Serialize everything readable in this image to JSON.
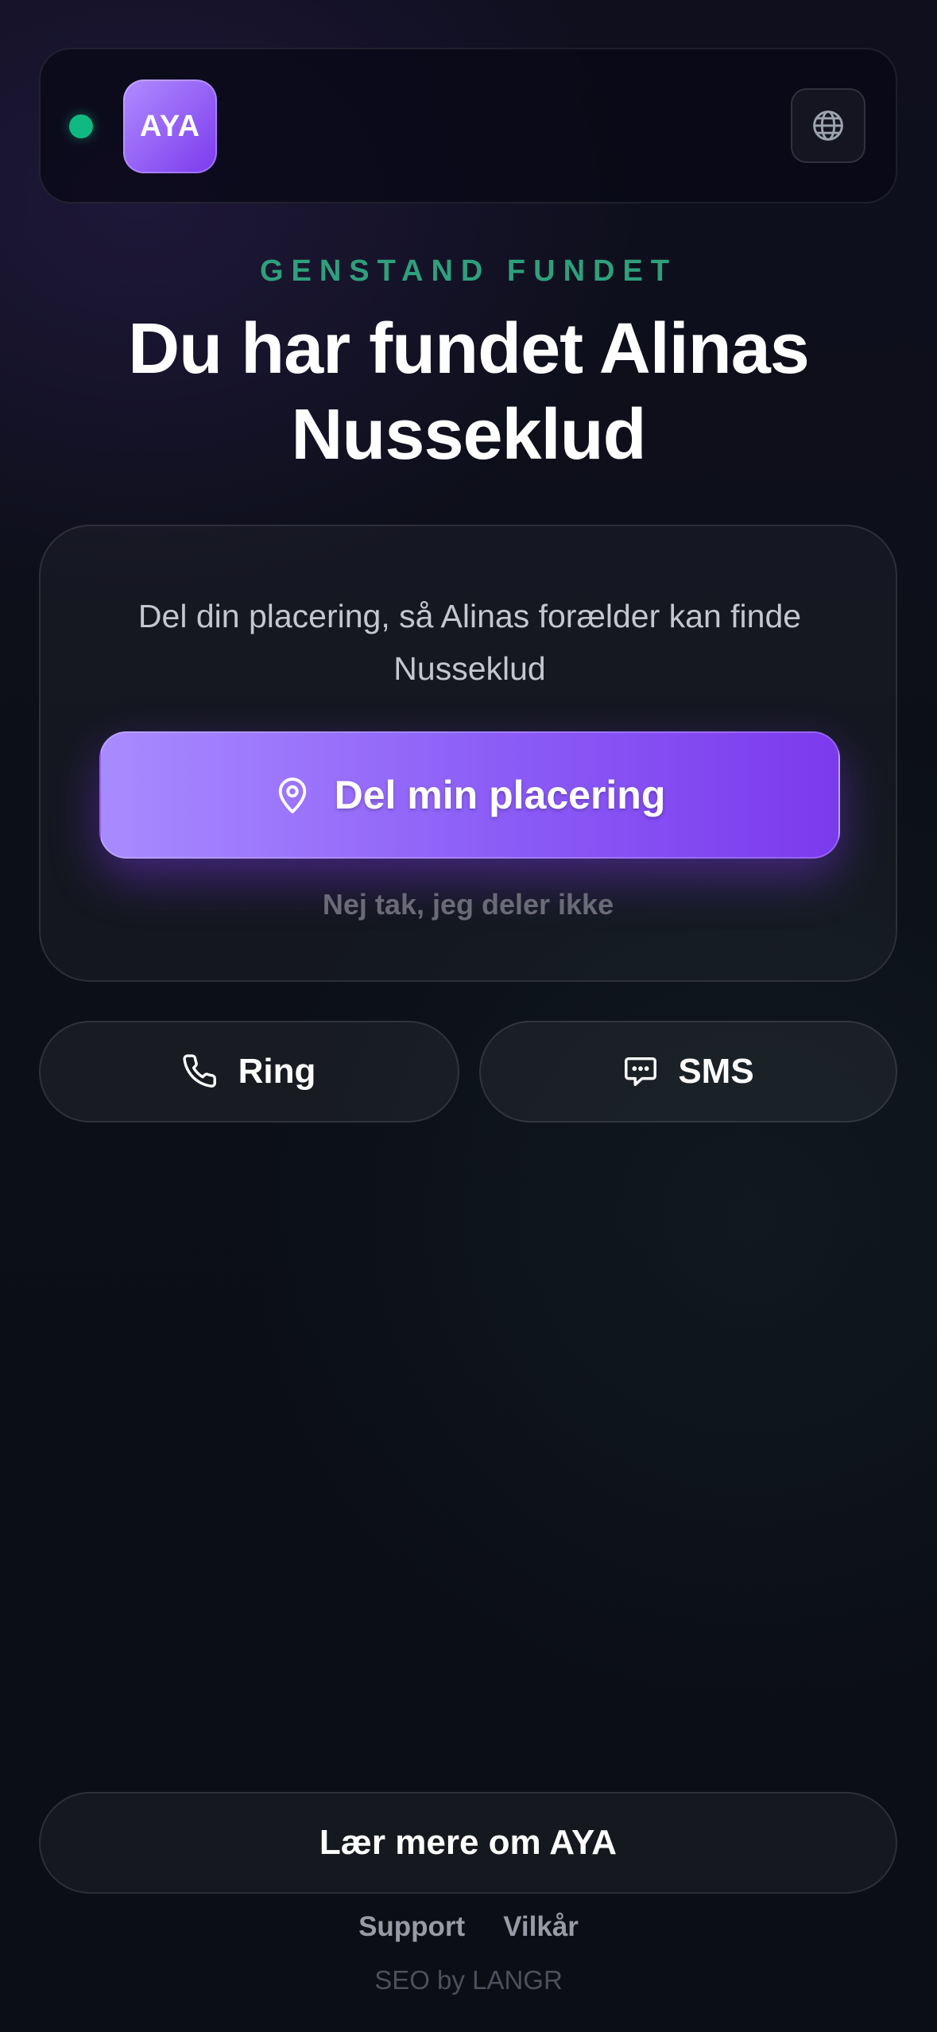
{
  "header": {
    "logo_text": "AYA",
    "status_color": "#10b981",
    "language_icon": "globe-icon"
  },
  "hero": {
    "eyebrow": "GENSTAND FUNDET",
    "title": "Du har fundet Alinas Nusseklud"
  },
  "share_card": {
    "text": "Del din placering, så Alinas forælder kan finde Nusseklud",
    "share_button_label": "Del min placering",
    "share_icon": "map-pin-icon",
    "decline_label": "Nej tak, jeg deler ikke"
  },
  "contact": {
    "call_label": "Ring",
    "call_icon": "phone-icon",
    "sms_label": "SMS",
    "sms_icon": "chat-bubble-icon"
  },
  "footer": {
    "learn_more_label": "Lær mere om AYA",
    "links": [
      "Support",
      "Vilkår"
    ],
    "credit": "SEO by LANGR"
  },
  "colors": {
    "accent": "#8b5cf6",
    "eyebrow": "#2f9f7c",
    "background": "#0c0f17"
  }
}
